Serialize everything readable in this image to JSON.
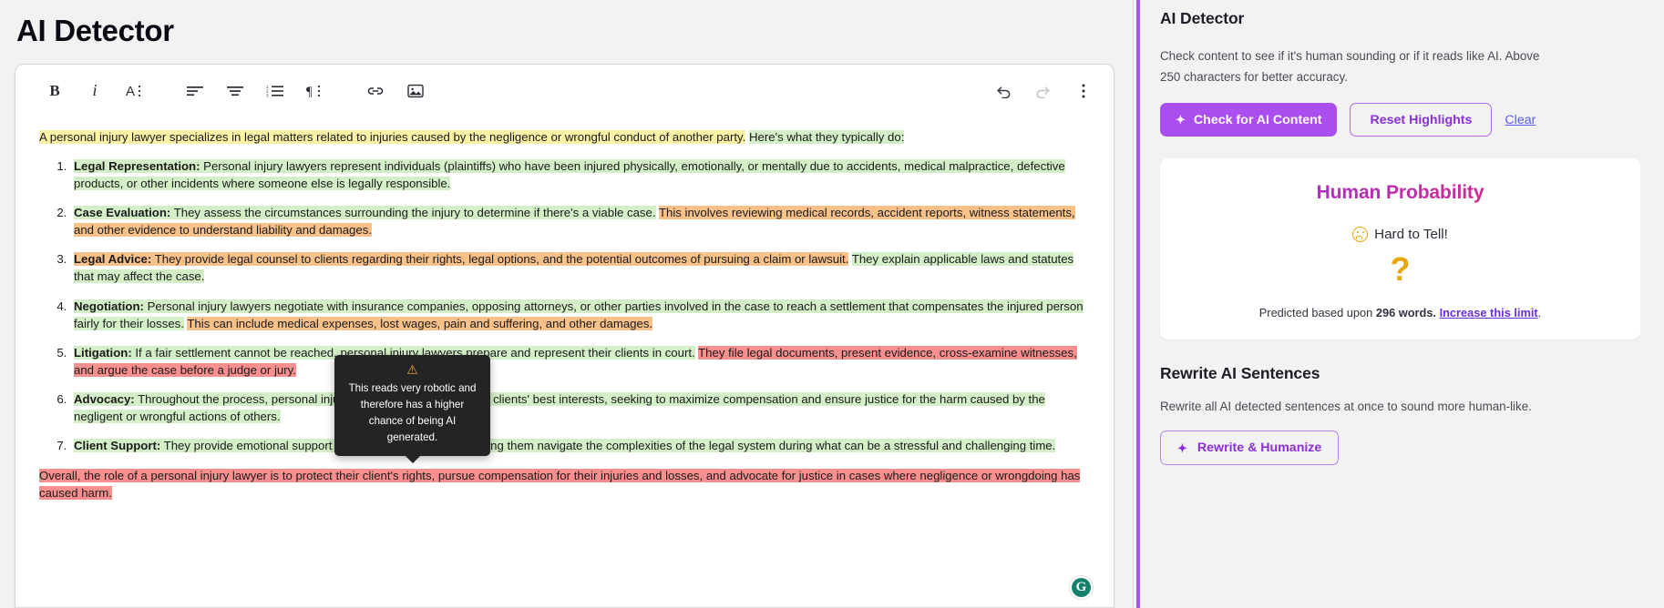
{
  "editor": {
    "page_title": "AI Detector",
    "toolbar": {
      "bold": "B",
      "italic": "i",
      "text_style": "A",
      "align_left": "align-left",
      "align_center": "align-center",
      "numbered_list": "numbered-list",
      "paragraph_style": "¶",
      "link": "link",
      "image": "image",
      "undo": "undo",
      "redo": "redo",
      "more": "more-options"
    },
    "grammarly_badge": "G",
    "tooltip": {
      "warning_icon": "warning-triangle",
      "text": "This reads very robotic and therefore has a higher chance of being AI generated."
    },
    "content": {
      "intro": [
        {
          "text": "A personal injury lawyer specializes in legal matters related to injuries caused by the negligence or wrongful conduct of another party.",
          "hl": "y"
        },
        {
          "text": " ",
          "hl": "n"
        },
        {
          "text": "Here's what they typically do:",
          "hl": "g"
        }
      ],
      "items": [
        {
          "label": "Legal Representation",
          "parts": [
            {
              "text": "Legal Representation:",
              "hl": "g",
              "bold": true
            },
            {
              "text": " Personal injury lawyers represent individuals (plaintiffs) who have been injured physically, emotionally, or mentally due to accidents, medical malpractice, defective products, or other incidents where someone else is legally responsible.",
              "hl": "g"
            }
          ]
        },
        {
          "label": "Case Evaluation",
          "parts": [
            {
              "text": "Case Evaluation:",
              "hl": "g",
              "bold": true
            },
            {
              "text": " They assess the circumstances surrounding the injury to determine if there's a viable case.",
              "hl": "g"
            },
            {
              "text": " ",
              "hl": "n"
            },
            {
              "text": "This involves reviewing medical records, accident reports, witness statements, and other evidence to understand liability and damages.",
              "hl": "o"
            }
          ]
        },
        {
          "label": "Legal Advice",
          "parts": [
            {
              "text": "Legal Advice:",
              "hl": "o",
              "bold": true
            },
            {
              "text": " They provide legal counsel to clients regarding their rights, legal options, and the potential outcomes of pursuing a claim or lawsuit.",
              "hl": "o"
            },
            {
              "text": " ",
              "hl": "n"
            },
            {
              "text": "They explain applicable laws and statutes that may affect the case.",
              "hl": "g"
            }
          ]
        },
        {
          "label": "Negotiation",
          "parts": [
            {
              "text": "Negotiation:",
              "hl": "g",
              "bold": true
            },
            {
              "text": " Personal injury lawyers negotiate with insurance companies, opposing attorneys, or other parties involved in the case to reach a settlement that compensates the injured person fairly for their losses.",
              "hl": "g"
            },
            {
              "text": " ",
              "hl": "n"
            },
            {
              "text": "This can include medical expenses, lost wages, pain and suffering, and other damages.",
              "hl": "o"
            }
          ]
        },
        {
          "label": "Litigation",
          "parts": [
            {
              "text": "Litigation:",
              "hl": "g",
              "bold": true
            },
            {
              "text": " If a fair settlement cannot be reached, personal injury lawyers prepare and represent their clients in court.",
              "hl": "g"
            },
            {
              "text": " ",
              "hl": "n"
            },
            {
              "text": "They file legal documents, present evidence, cross-examine witnesses, and argue the case before a judge or jury.",
              "hl": "r"
            }
          ]
        },
        {
          "label": "Advocacy",
          "parts": [
            {
              "text": "Advocacy:",
              "hl": "g",
              "bold": true
            },
            {
              "text": " Throughout the process, personal injury lawyers advocate for their clients' best interests, seeking to maximize compensation and ensure justice for the harm caused by the negligent or wrongful actions of others.",
              "hl": "g"
            }
          ]
        },
        {
          "label": "Client Support",
          "parts": [
            {
              "text": "Client Support:",
              "hl": "g",
              "bold": true
            },
            {
              "text": " They provide emotional support and guidance to clients, helping them navigate the complexities of the legal system during what can be a stressful and challenging time.",
              "hl": "g"
            }
          ]
        }
      ],
      "outro": [
        {
          "text": "Overall, the role of a personal injury lawyer is to protect their client's rights, pursue compensation for their injuries and losses, and advocate for justice in cases where negligence or wrongdoing has caused harm.",
          "hl": "r"
        }
      ]
    }
  },
  "sidebar": {
    "title": "AI Detector",
    "description": "Check content to see if it's human sounding or if it reads like AI. Above 250 characters for better accuracy.",
    "check_button": "Check for AI Content",
    "reset_button": "Reset Highlights",
    "clear_link": "Clear",
    "result": {
      "heading": "Human Probability",
      "verdict": "Hard to Tell!",
      "symbol": "?",
      "prediction_prefix": "Predicted based upon ",
      "word_count": "296 words.",
      "increase_link": "Increase this limit",
      "prediction_suffix": "."
    },
    "rewrite": {
      "title": "Rewrite AI Sentences",
      "description": "Rewrite all AI detected sentences at once to sound more human-like.",
      "button": "Rewrite & Humanize"
    }
  },
  "colors": {
    "accent_purple": "#a855f7",
    "primary_button": "#ab4ef0",
    "link_blue": "#5b5bf5",
    "highlight_yellow": "#fbf2a6",
    "highlight_green": "#d4efc8",
    "highlight_orange": "#f9c18a",
    "highlight_red": "#f98f8f",
    "warn_amber": "#e8a80c",
    "grammarly_green": "#15806a"
  }
}
